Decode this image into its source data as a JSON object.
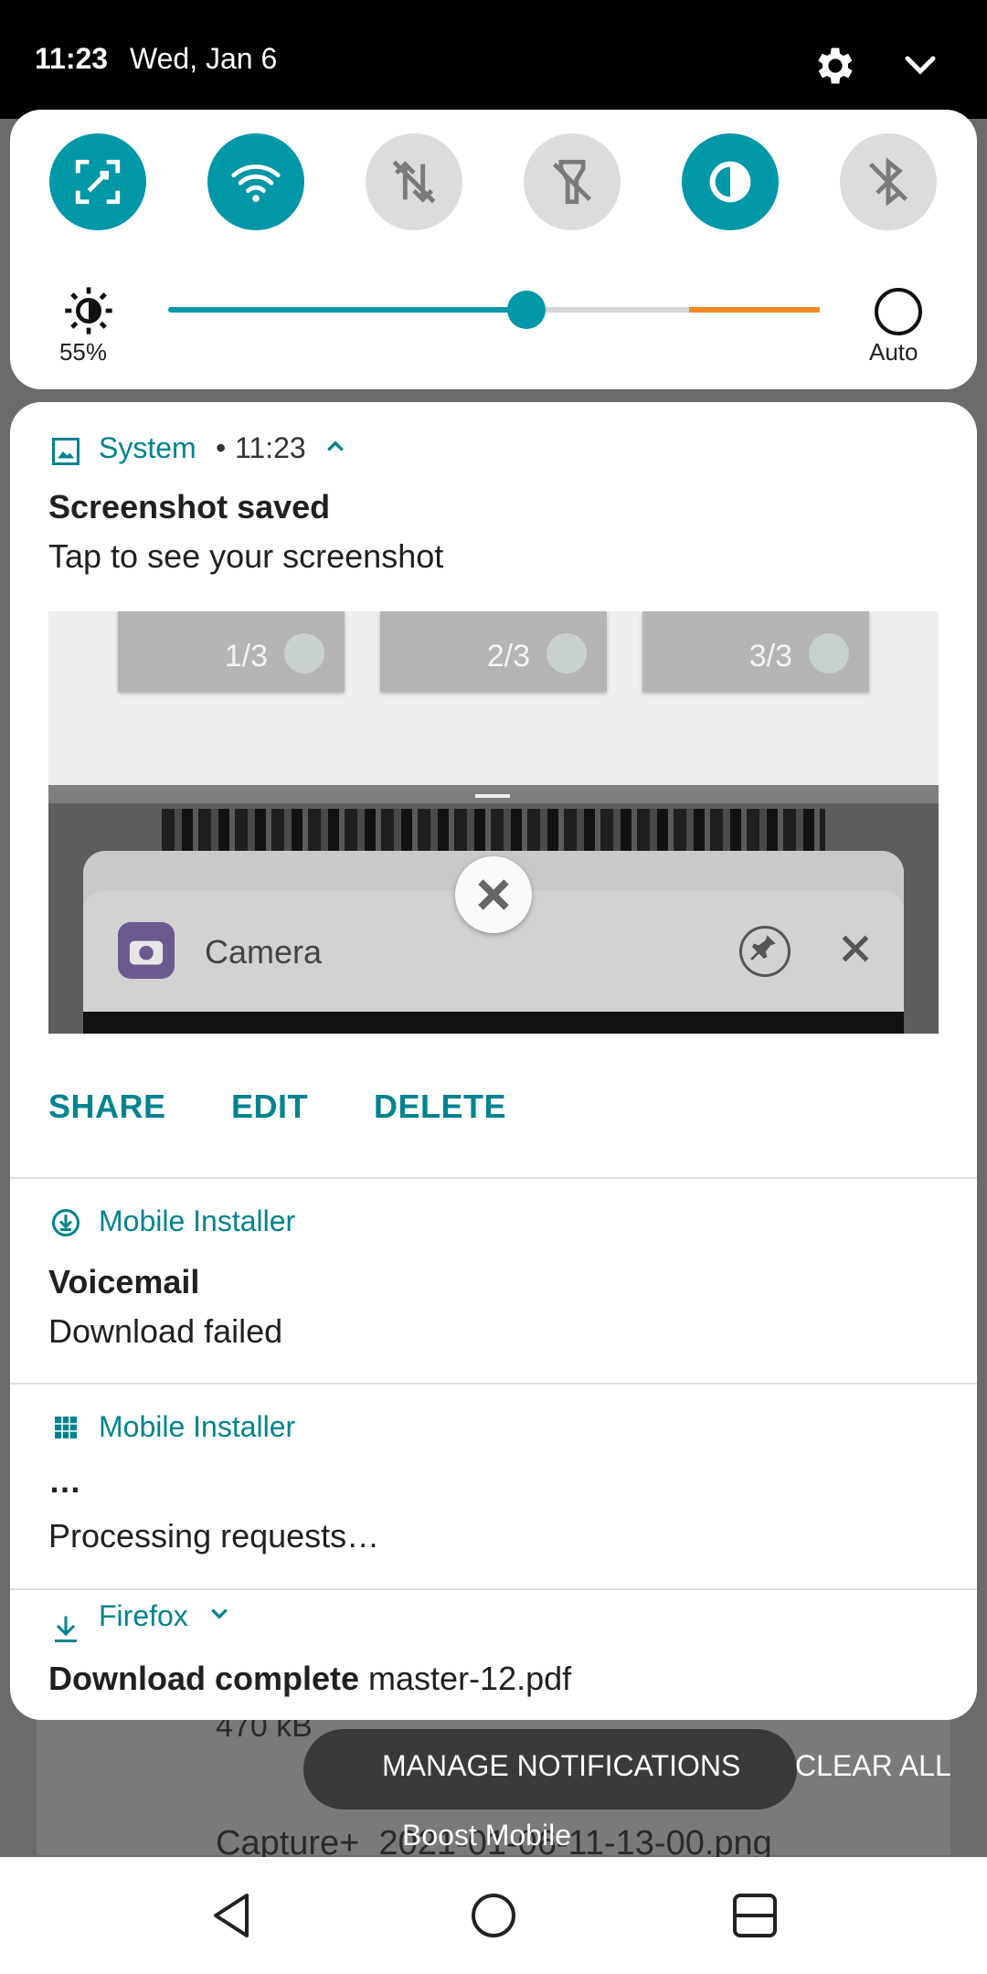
{
  "status_bar": {
    "time": "11:23",
    "date": "Wed, Jan 6"
  },
  "quick_settings": {
    "tiles": [
      {
        "name": "screen-capture",
        "active": true
      },
      {
        "name": "wifi",
        "active": true
      },
      {
        "name": "mobile-data",
        "active": false
      },
      {
        "name": "flashlight",
        "active": false
      },
      {
        "name": "color-invert",
        "active": true
      },
      {
        "name": "bluetooth",
        "active": false
      }
    ],
    "brightness_percent": "55%",
    "brightness_level": 0.55,
    "auto_label": "Auto",
    "accent_color": "#0097a7",
    "warning_color": "#f08a24"
  },
  "notifications": {
    "system": {
      "app": "System",
      "time": "11:23",
      "title": "Screenshot saved",
      "body": "Tap to see your screenshot",
      "preview": {
        "pages": [
          "1/3",
          "2/3",
          "3/3"
        ],
        "app_name": "Camera"
      },
      "actions": [
        "SHARE",
        "EDIT",
        "DELETE"
      ]
    },
    "installer_voicemail": {
      "app": "Mobile Installer",
      "title": "Voicemail",
      "body": "Download failed"
    },
    "installer_processing": {
      "app": "Mobile Installer",
      "title": "…",
      "body": "Processing requests…"
    },
    "firefox": {
      "app": "Firefox",
      "title": "Download complete",
      "file": "master-12.pdf"
    }
  },
  "footer": {
    "manage": "MANAGE NOTIFICATIONS",
    "clear_all": "CLEAR ALL",
    "carrier": "Boost Mobile",
    "background_size": "470 kB",
    "background_file": "Capture+_2021-01-06-11-13-00.png"
  }
}
